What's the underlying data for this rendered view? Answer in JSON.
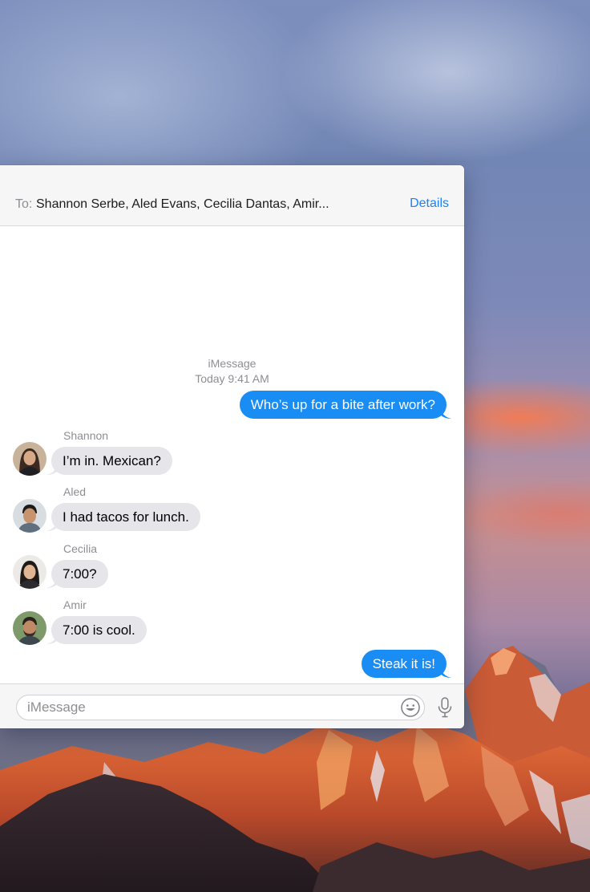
{
  "header": {
    "to_label": "To:",
    "recipients": "Shannon Serbe, Aled Evans, Cecilia Dantas, Amir...",
    "details_label": "Details"
  },
  "conversation": {
    "service": "iMessage",
    "time": "Today 9:41 AM",
    "messages": [
      {
        "direction": "outgoing",
        "text": "Who’s up for a bite after work?"
      },
      {
        "direction": "incoming",
        "sender": "Shannon",
        "text": "I’m in. Mexican?"
      },
      {
        "direction": "incoming",
        "sender": "Aled",
        "text": "I had tacos for lunch."
      },
      {
        "direction": "incoming",
        "sender": "Cecilia",
        "text": "7:00?"
      },
      {
        "direction": "incoming",
        "sender": "Amir",
        "text": "7:00 is cool."
      },
      {
        "direction": "outgoing",
        "text": "Steak it is!"
      }
    ]
  },
  "composer": {
    "placeholder": "iMessage",
    "emoji_icon": "smiley-face-icon",
    "mic_icon": "microphone-icon"
  },
  "colors": {
    "accent": "#1a82fb",
    "outgoing_bubble": "#1a8df5",
    "incoming_bubble": "#e5e5ea"
  }
}
